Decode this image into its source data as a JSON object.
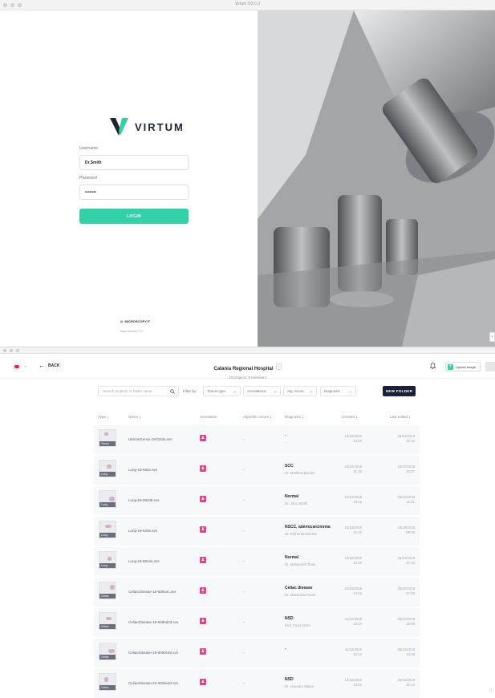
{
  "login_window": {
    "title": "Virtum OS 0.3",
    "logo_text": "VIRTUM",
    "username_label": "Username",
    "username_value": "Dr.Smith",
    "password_label": "Password",
    "password_value": "••••••••",
    "login_label": "LOGIN",
    "brand": "MICROSCOPY.IT",
    "app_version": "App version 0.3",
    "accent": "#33d1a8",
    "logo_colors": [
      "#1f2430",
      "#33d1a8"
    ]
  },
  "app_window": {
    "back_label": "BACK",
    "hospital_name": "Catania Regional Hospital",
    "hospital_menu": "⋮",
    "hospital_sub": "18 projects, 9 members",
    "upload_label": "Upload Image",
    "search_placeholder": "Search projects or folder name",
    "filter_by": "Filter by:",
    "filters": [
      "Tissue type",
      "Annotations",
      "Alg. Score",
      "Diagnosis"
    ],
    "new_folder": "NEW FOLDER",
    "columns": {
      "type": "Type",
      "name": "Name",
      "annotation": "Annotation",
      "algorithm_score": "Algorithm Score",
      "diagnosis": "Diagnosis",
      "created": "Created",
      "last_edited": "Last edited"
    },
    "annotation_color": "#ea3f8a",
    "rows": [
      {
        "tag": "Cervix",
        "name": "UterineCervix-19-f210a.svs",
        "score": "-",
        "diagnosis": "-",
        "doctor": "-",
        "created": "12/10/2019 13:45",
        "edited": "25/10/2019 12:14"
      },
      {
        "tag": "Lung",
        "name": "Lung-19-6652.svs",
        "score": "-",
        "diagnosis": "SCC",
        "doctor": "Dr. Matthew Bunker",
        "created": "10/10/2019 11:32",
        "edited": "18/10/2019 10:37"
      },
      {
        "tag": "Lung",
        "name": "Lung-19-9844b.svs",
        "score": "-",
        "diagnosis": "Normal",
        "doctor": "Dr. John Smith",
        "created": "12/10/2019 10:21",
        "edited": "20/10/2019 11:41"
      },
      {
        "tag": "Lung",
        "name": "Lung-19-6255.svs",
        "score": "-",
        "diagnosis": "NSCC, adenocarcinoma",
        "doctor": "Dr. Rutherford Brown",
        "created": "10/10/2019 11:32",
        "edited": "18/10/2019 09:18"
      },
      {
        "tag": "Lung",
        "name": "Lung-19-6944a.svs",
        "score": "-",
        "diagnosis": "Normal",
        "doctor": "Dr. Masoud El Touni",
        "created": "12/10/2019 13:45",
        "edited": "25/10/2019 17:53"
      },
      {
        "tag": "Celiac",
        "name": "CeliacDisease-19-6891ec.svs",
        "score": "-",
        "diagnosis": "Celiac disease",
        "doctor": "Dr. Masoud El Touni",
        "created": "12/10/2019 13:45",
        "edited": "25/10/2019 17:53"
      },
      {
        "tag": "Celiac",
        "name": "CeliacDisease-19-6286d43.svs",
        "score": "-",
        "diagnosis": "NSD",
        "doctor": "Prof. Farid Amini",
        "created": "11/10/2019 13:14",
        "edited": "29/10/2019 10:46"
      },
      {
        "tag": "Celiac",
        "name": "CeliacDisease-19-6090cd3.svs",
        "score": "-",
        "diagnosis": "-",
        "doctor": "-",
        "created": "11/10/2019 13:14",
        "edited": "28/10/2019 14:28"
      },
      {
        "tag": "Celiac",
        "name": "CeliacDisease-19-4029cd3.svs",
        "score": "-",
        "diagnosis": "NSD",
        "doctor": "Dr. Lisandro Matos",
        "created": "12/10/2019 13:45",
        "edited": "25/10/2019 12:14"
      }
    ]
  }
}
